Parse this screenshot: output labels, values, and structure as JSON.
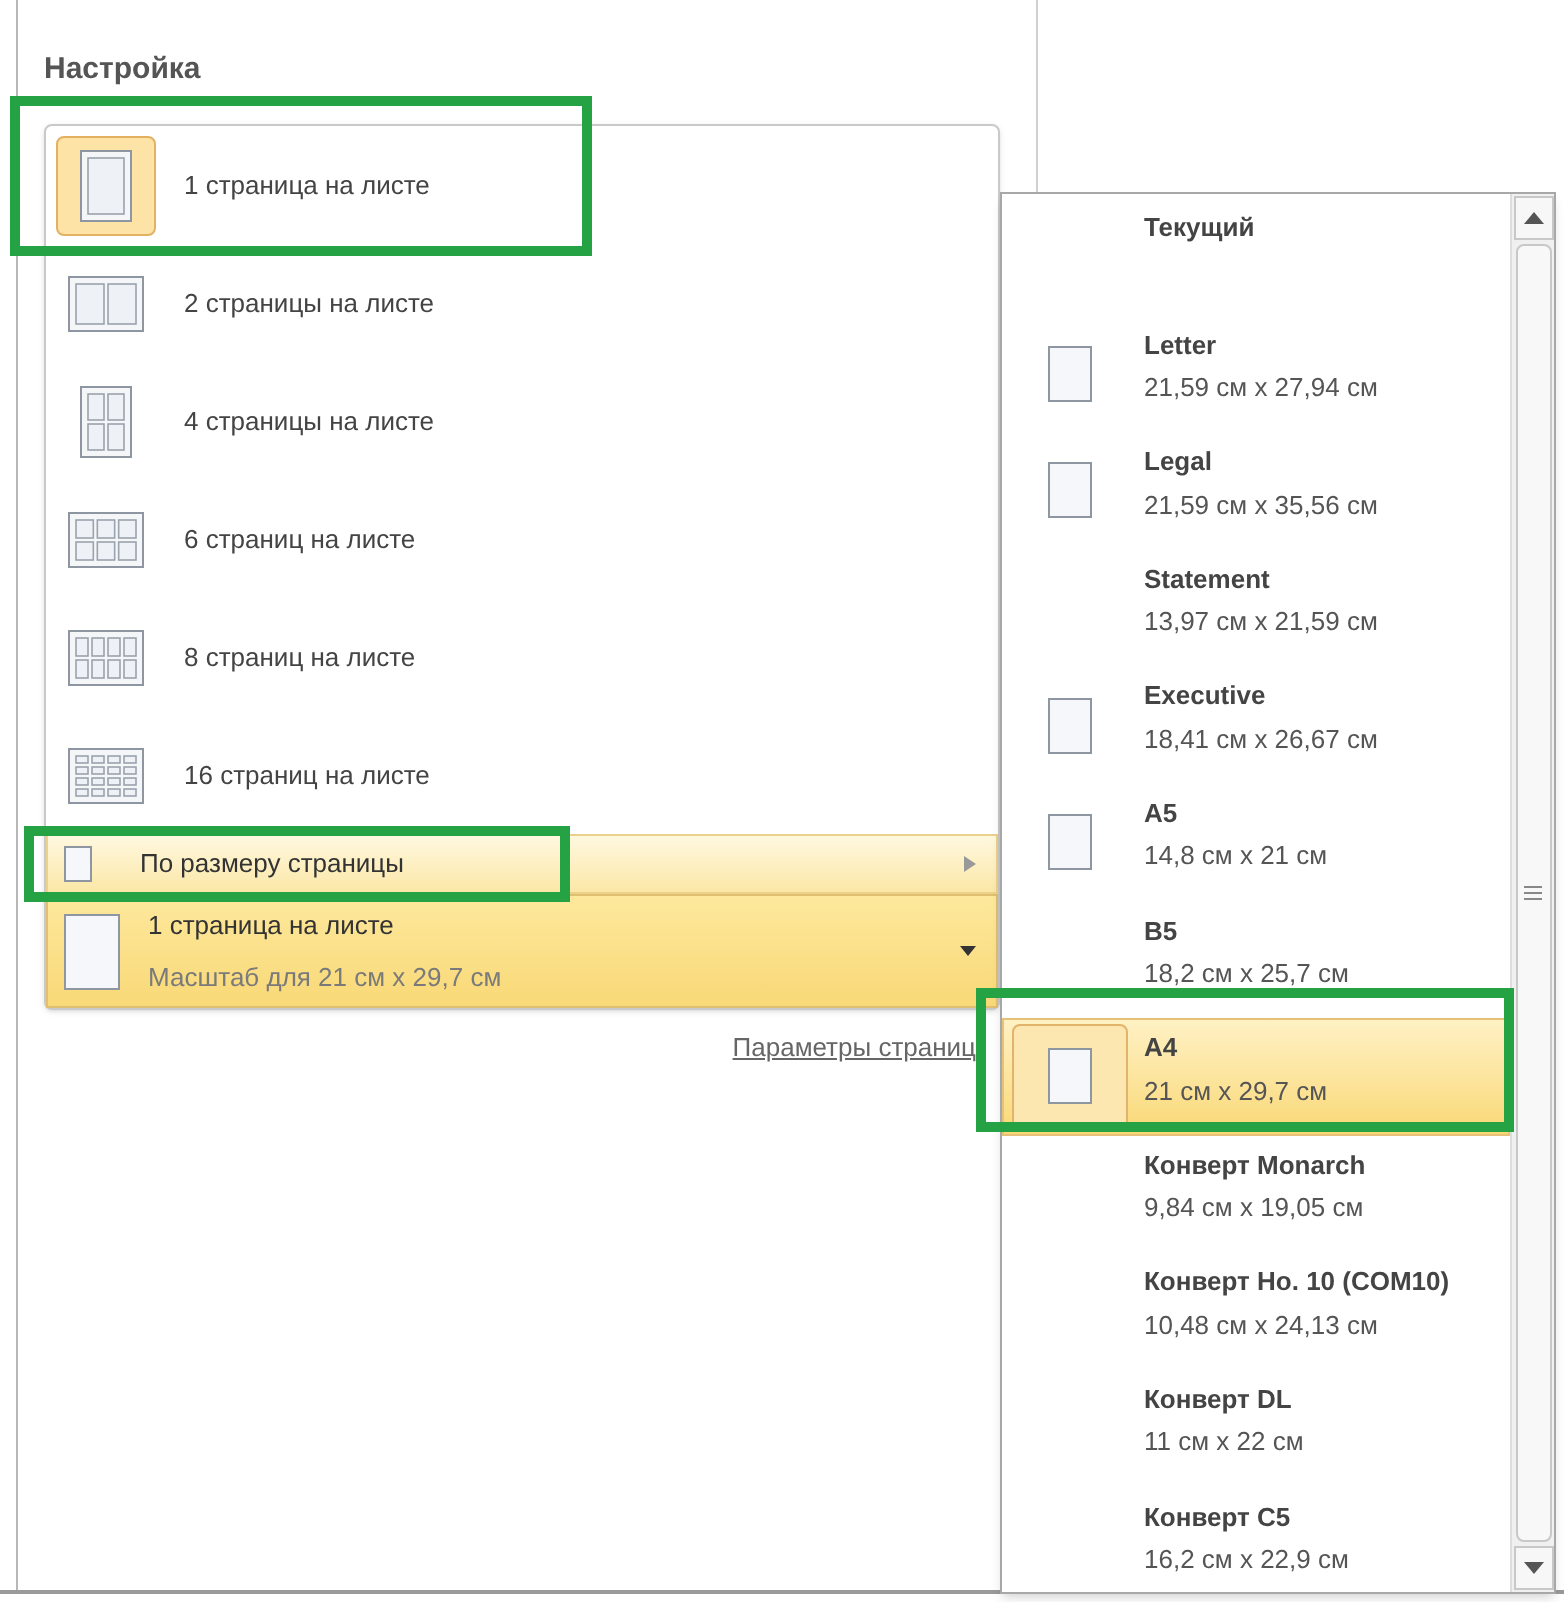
{
  "section_title": "Настройка",
  "pages_per_sheet": [
    {
      "label": "1 страница на листе",
      "selected": true
    },
    {
      "label": "2 страницы на листе",
      "selected": false
    },
    {
      "label": "4 страницы на листе",
      "selected": false
    },
    {
      "label": "6 страниц на листе",
      "selected": false
    },
    {
      "label": "8 страниц на листе",
      "selected": false
    },
    {
      "label": "16 страниц на листе",
      "selected": false
    }
  ],
  "fit_item": {
    "label": "По размеру страницы",
    "expanded": true
  },
  "current_setting": {
    "title": "1 страница на листе",
    "subtitle": "Масштаб для 21 см x 29,7 см"
  },
  "page_setup_link": "Параметры страниц",
  "paper_sizes": [
    {
      "name": "Текущий",
      "kind": "heading",
      "selected": false
    },
    {
      "name": "Letter",
      "size": "21,59 см x 27,94 см",
      "kind": "page",
      "selected": false
    },
    {
      "name": "Legal",
      "size": "21,59 см x 35,56 см",
      "kind": "page",
      "selected": false
    },
    {
      "name": "Statement",
      "size": "13,97 см x 21,59 см",
      "kind": "plain",
      "selected": false
    },
    {
      "name": "Executive",
      "size": "18,41 см x 26,67 см",
      "kind": "page",
      "selected": false
    },
    {
      "name": "A5",
      "size": "14,8 см x 21 см",
      "kind": "page",
      "selected": false
    },
    {
      "name": "B5",
      "size": "18,2 см x 25,7 см",
      "kind": "plain",
      "selected": false
    },
    {
      "name": "A4",
      "size": "21 см x 29,7 см",
      "kind": "page",
      "selected": true
    },
    {
      "name": "Конверт Monarch",
      "size": "9,84 см x 19,05 см",
      "kind": "plain",
      "selected": false
    },
    {
      "name": "Конверт Но. 10 (COM10)",
      "size": "10,48 см x 24,13 см",
      "kind": "plain",
      "selected": false
    },
    {
      "name": "Конверт DL",
      "size": "11 см x 22 см",
      "kind": "plain",
      "selected": false
    },
    {
      "name": "Конверт C5",
      "size": "16,2 см x 22,9 см",
      "kind": "plain",
      "selected": false
    }
  ]
}
